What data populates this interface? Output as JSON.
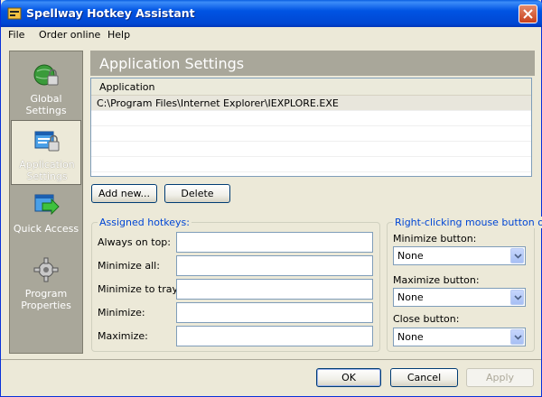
{
  "window": {
    "title": "Spellway Hotkey Assistant"
  },
  "menu": [
    "File",
    "Order online",
    "Help"
  ],
  "nav": [
    {
      "label": "Global Settings",
      "icon": "globe-lock-icon",
      "selected": false
    },
    {
      "label": "Application Settings",
      "icon": "window-lock-icon",
      "selected": true
    },
    {
      "label": "Quick Access",
      "icon": "arrow-window-icon",
      "selected": false
    },
    {
      "label": "Program Properties",
      "icon": "gear-icon",
      "selected": false
    }
  ],
  "section": {
    "title": "Application Settings"
  },
  "app_list": {
    "column": "Application",
    "rows": [
      "C:\\Program Files\\Internet Explorer\\IEXPLORE.EXE"
    ]
  },
  "list_buttons": {
    "add": "Add new...",
    "delete": "Delete"
  },
  "hotkeys": {
    "title": "Assigned hotkeys:",
    "fields": [
      {
        "label": "Always on top:",
        "value": ""
      },
      {
        "label": "Minimize all:",
        "value": ""
      },
      {
        "label": "Minimize to tray:",
        "value": ""
      },
      {
        "label": "Minimize:",
        "value": ""
      },
      {
        "label": "Maximize:",
        "value": ""
      }
    ]
  },
  "mouse": {
    "title": "Right-clicking mouse button on",
    "fields": [
      {
        "label": "Minimize button:",
        "value": "None"
      },
      {
        "label": "Maximize button:",
        "value": "None"
      },
      {
        "label": "Close button:",
        "value": "None"
      }
    ]
  },
  "dialog_buttons": {
    "ok": "OK",
    "cancel": "Cancel",
    "apply": "Apply"
  },
  "colors": {
    "titlebar": "#0054e3",
    "panel": "#a9a79a",
    "group_title": "#0046d5"
  }
}
